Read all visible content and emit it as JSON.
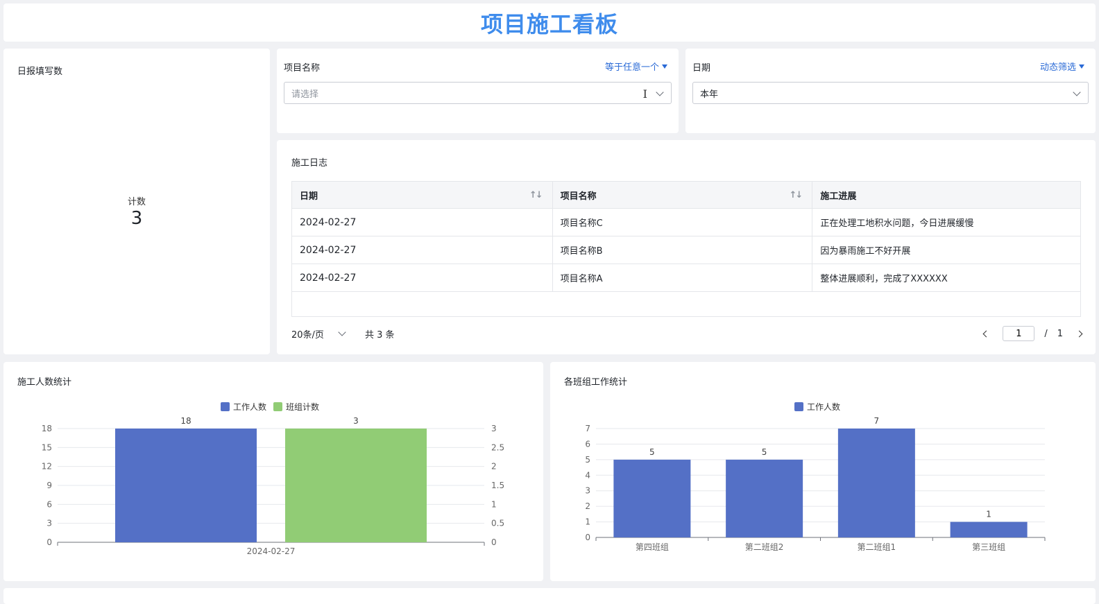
{
  "header": {
    "title": "项目施工看板"
  },
  "count_card": {
    "title": "日报填写数",
    "metric_label": "计数",
    "metric_value": "3"
  },
  "filters": {
    "project": {
      "label": "项目名称",
      "mode": "等于任意一个",
      "placeholder": "请选择"
    },
    "date": {
      "label": "日期",
      "mode": "动态筛选",
      "value": "本年"
    }
  },
  "log": {
    "title": "施工日志",
    "columns": [
      "日期",
      "项目名称",
      "施工进展"
    ],
    "rows": [
      [
        "2024-02-27",
        "项目名称C",
        "正在处理工地积水问题，今日进展缓慢"
      ],
      [
        "2024-02-27",
        "项目名称B",
        "因为暴雨施工不好开展"
      ],
      [
        "2024-02-27",
        "项目名称A",
        "整体进展顺利，完成了XXXXXX"
      ]
    ],
    "pager": {
      "page_size": "20条/页",
      "total": "共 3 条",
      "page": "1",
      "slash": "/",
      "pages": "1"
    }
  },
  "colors": {
    "blue": "#5470c6",
    "green": "#91cc75",
    "title": "#3f8cec"
  },
  "chart_data": [
    {
      "type": "bar",
      "title": "施工人数统计",
      "categories": [
        "2024-02-27"
      ],
      "series": [
        {
          "name": "工作人数",
          "values": [
            18
          ],
          "axis": "left",
          "color": "#5470c6"
        },
        {
          "name": "班组计数",
          "values": [
            3
          ],
          "axis": "right",
          "color": "#91cc75"
        }
      ],
      "ylim": [
        0,
        18
      ],
      "y_ticks": [
        0,
        3,
        6,
        9,
        12,
        15,
        18
      ],
      "y2lim": [
        0,
        3
      ],
      "y2_ticks": [
        "0",
        "0.5",
        "1",
        "1.5",
        "2",
        "2.5",
        "3"
      ],
      "legend": "top-center",
      "grid": true
    },
    {
      "type": "bar",
      "title": "各班组工作统计",
      "categories": [
        "第四班组",
        "第二班组2",
        "第二班组1",
        "第三班组"
      ],
      "series": [
        {
          "name": "工作人数",
          "values": [
            5,
            5,
            7,
            1
          ],
          "color": "#5470c6"
        }
      ],
      "ylim": [
        0,
        7
      ],
      "y_ticks": [
        0,
        1,
        2,
        3,
        4,
        5,
        6,
        7
      ],
      "legend": "top-center",
      "grid": true
    }
  ]
}
